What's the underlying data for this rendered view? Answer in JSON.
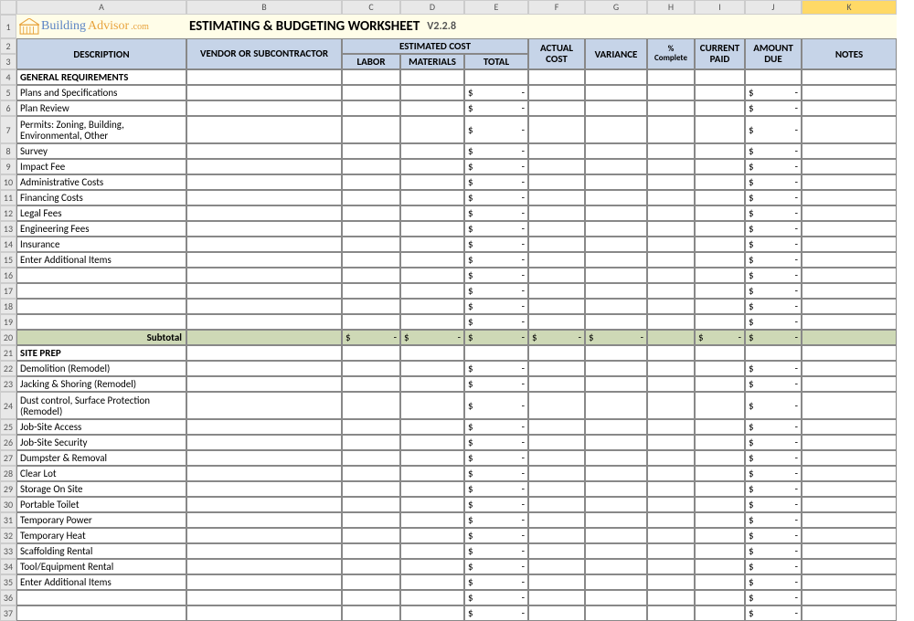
{
  "columns": [
    "",
    "A",
    "B",
    "C",
    "D",
    "E",
    "F",
    "G",
    "H",
    "I",
    "J",
    "K"
  ],
  "logo": {
    "brand_left": "Building",
    "brand_right": "Advisor",
    "tld": ".com"
  },
  "title": "ESTIMATING & BUDGETING WORKSHEET",
  "version": "V2.2.8",
  "headers": {
    "description": "DESCRIPTION",
    "vendor": "VENDOR  OR SUBCONTRACTOR",
    "est_cost": "ESTIMATED COST",
    "labor": "LABOR",
    "materials": "MATERIALS",
    "total": "TOTAL",
    "actual": "ACTUAL COST",
    "variance": "VARIANCE",
    "pct": "% Complete",
    "paid": "CURRENT PAID",
    "due": "AMOUNT DUE",
    "notes": "NOTES"
  },
  "sections": [
    {
      "row": 4,
      "heading": "GENERAL REQUIREMENTS",
      "items": [
        {
          "row": 5,
          "desc": "Plans and Specifications"
        },
        {
          "row": 6,
          "desc": "Plan Review"
        },
        {
          "row": 7,
          "desc": "Permits: Zoning, Building, Environmental, Other",
          "wrap": true
        },
        {
          "row": 8,
          "desc": "Survey"
        },
        {
          "row": 9,
          "desc": "Impact Fee"
        },
        {
          "row": 10,
          "desc": "Administrative Costs"
        },
        {
          "row": 11,
          "desc": "Financing Costs"
        },
        {
          "row": 12,
          "desc": "Legal Fees"
        },
        {
          "row": 13,
          "desc": "Engineering Fees"
        },
        {
          "row": 14,
          "desc": "Insurance"
        },
        {
          "row": 15,
          "desc": "Enter Additional Items"
        },
        {
          "row": 16,
          "desc": ""
        },
        {
          "row": 17,
          "desc": ""
        },
        {
          "row": 18,
          "desc": ""
        },
        {
          "row": 19,
          "desc": ""
        }
      ],
      "subtotal_row": 20,
      "subtotal_label": "Subtotal"
    },
    {
      "row": 21,
      "heading": "SITE PREP",
      "items": [
        {
          "row": 22,
          "desc": "Demolition (Remodel)"
        },
        {
          "row": 23,
          "desc": "Jacking & Shoring (Remodel)"
        },
        {
          "row": 24,
          "desc": "Dust control, Surface Protection (Remodel)",
          "wrap": true
        },
        {
          "row": 25,
          "desc": "Job-Site Access"
        },
        {
          "row": 26,
          "desc": "Job-Site Security"
        },
        {
          "row": 27,
          "desc": "Dumpster & Removal"
        },
        {
          "row": 28,
          "desc": "Clear Lot"
        },
        {
          "row": 29,
          "desc": "Storage On Site"
        },
        {
          "row": 30,
          "desc": "Portable Toilet"
        },
        {
          "row": 31,
          "desc": "Temporary Power"
        },
        {
          "row": 32,
          "desc": "Temporary Heat"
        },
        {
          "row": 33,
          "desc": "Scaffolding Rental"
        },
        {
          "row": 34,
          "desc": "Tool/Equipment Rental"
        },
        {
          "row": 35,
          "desc": "Enter Additional Items"
        },
        {
          "row": 36,
          "desc": ""
        },
        {
          "row": 37,
          "desc": ""
        }
      ]
    }
  ],
  "last_visible_row": 37
}
